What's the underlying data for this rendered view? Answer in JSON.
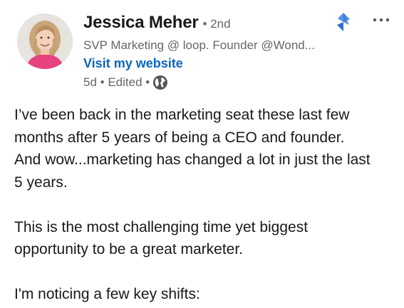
{
  "author": {
    "name": "Jessica Meher",
    "degree_separator": "•",
    "degree": "2nd",
    "headline": "SVP Marketing @ loop. Founder @Wond...",
    "website_label": "Visit my website",
    "time": "5d",
    "edited": "Edited",
    "avatar_icon": "profile-photo",
    "visibility_icon": "globe-icon"
  },
  "controls": {
    "brand_icon": "lightning-bolt-icon",
    "more_icon": "more-options-icon",
    "more_label": "···"
  },
  "post": {
    "paragraph_1_lines": [
      "I’ve been back in the marketing seat these last few",
      "months after 5 years of being a CEO and founder.",
      "And wow...marketing has changed a lot in just the last",
      "5 years."
    ],
    "paragraph_2_lines": [
      "This is the most challenging time yet biggest",
      "opportunity to be a great marketer."
    ],
    "paragraph_3_lines": [
      "I'm noticing a few key shifts:"
    ]
  },
  "colors": {
    "link_blue": "#0a66c2",
    "muted_text": "#666666",
    "body_text": "#191919",
    "brand_blue": "#3b7de0"
  }
}
